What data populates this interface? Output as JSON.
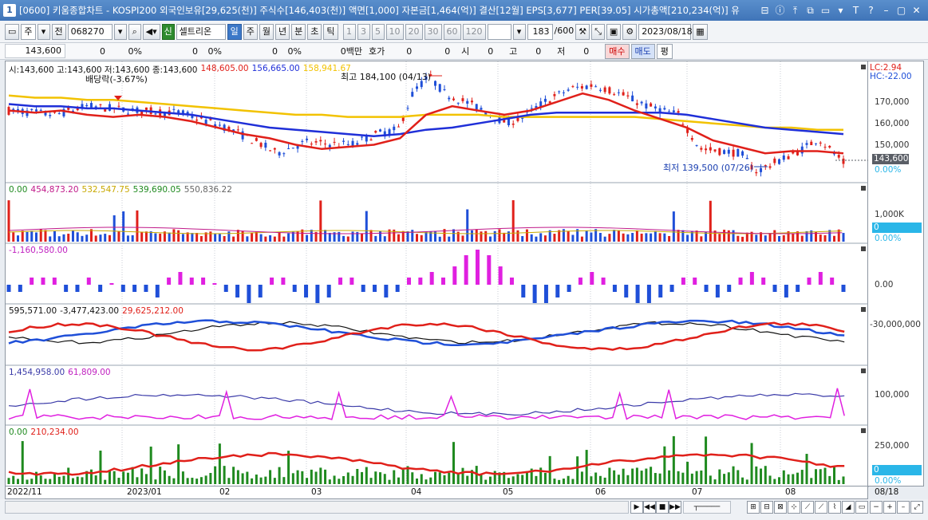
{
  "window": {
    "number": "1",
    "title": "[0600] 키움종합차트 - KOSPI200 외국인보유[29,625(천)] 주식수[146,403(천)] 액면[1,000] 자본금[1,464(억)] 결산[12월] EPS[3,677] PER[39.05] 시가총액[210,234(억)] 유",
    "buttons": [
      "⊟",
      "ⓘ",
      "⤒",
      "⧉",
      "▭",
      "▾",
      "T",
      "?",
      "–",
      "▢",
      "✕"
    ]
  },
  "toolbar": {
    "market": "주",
    "whole": "전",
    "code": "068270",
    "stock_name": "셀트리온",
    "periods": [
      "일",
      "주",
      "월",
      "년",
      "분",
      "초",
      "틱"
    ],
    "selected_period": "일",
    "intervals": [
      "1",
      "3",
      "5",
      "10",
      "20",
      "30",
      "60",
      "120"
    ],
    "count": "183",
    "max_count": "/600",
    "date": "2023/08/18"
  },
  "infobar": {
    "price": "143,600",
    "change": "0",
    "rate": "0%",
    "v1": "0",
    "v1_rate": "0%",
    "v2": "0",
    "v2_rate": "0%",
    "amount": "0백만",
    "hoga_label": "호가",
    "hoga_v1": "0",
    "hoga_v2": "0",
    "si_label": "시",
    "si_val": "0",
    "go_label": "고",
    "go_val": "0",
    "jeo_label": "저",
    "jeo_val": "0",
    "buy": "매수",
    "sell": "매도",
    "flat": "평"
  },
  "price_panel": {
    "ohlc": "시:143,600 고:143,600 저:143,600 종:143,600",
    "ma1": "148,605.00",
    "ma2": "156,665.00",
    "ma3": "158,941.67",
    "dividend": "배당락(-3.67%)",
    "high_label": "최고 184,100 (04/13)",
    "low_label": "최저 139,500 (07/26)",
    "lc": "LC:2.94",
    "hc": "HC:-22.00",
    "current_price": "143,600",
    "zero_pct": "0.00%",
    "ticks": [
      "170,000",
      "160,000",
      "150,000"
    ]
  },
  "volume_panel": {
    "legend": [
      "0.00",
      "454,873.20",
      "532,547.75",
      "539,690.05",
      "550,836.22"
    ],
    "tick": "1,000K",
    "zero": "0",
    "zero_pct": "0.00%"
  },
  "foreign_panel": {
    "legend": "-1,160,580.00",
    "tick": "0.00"
  },
  "flow_panel": {
    "legend": [
      "595,571.00",
      "-3,477,423.00",
      "29,625,212.00"
    ],
    "tick": "-30,000,000"
  },
  "short_panel": {
    "legend": [
      "1,454,958.00",
      "61,809.00"
    ],
    "tick": "100,000"
  },
  "cap_panel": {
    "legend": [
      "0.00",
      "210,234.00"
    ],
    "tick": "250,000",
    "zero": "0",
    "zero_pct": "0.00%"
  },
  "date_axis": [
    "2022/11",
    "2023/01",
    "02",
    "03",
    "04",
    "05",
    "06",
    "07",
    "08",
    "08/18"
  ],
  "colors": {
    "up": "#e0201a",
    "down": "#1f4fd8",
    "ma_red": "#e0201a",
    "ma_blue": "#1f2fd8",
    "ma_yellow": "#f2c200",
    "magenta": "#e020e0",
    "green": "#1f8a1f",
    "cyan": "#2ab6e8"
  },
  "chart_data": {
    "type": "candlestick",
    "categories": [
      "2022/11",
      "2023/01",
      "02",
      "03",
      "04",
      "05",
      "06",
      "07",
      "08"
    ],
    "price_ma_short": [
      168000,
      167000,
      168000,
      166000,
      165000,
      166000,
      165000,
      163000,
      160000,
      157000,
      155000,
      152000,
      150000,
      151000,
      152000,
      155000,
      166000,
      170000,
      168000,
      166000,
      168000,
      172000,
      176000,
      173000,
      168000,
      164000,
      160000,
      154000,
      151000,
      148000,
      149000,
      149000,
      148000
    ],
    "price_ma_mid": [
      171000,
      170000,
      170000,
      169000,
      169000,
      168000,
      167000,
      166000,
      164000,
      162000,
      160000,
      159000,
      158000,
      157000,
      156000,
      157000,
      159000,
      160000,
      162000,
      164000,
      166000,
      167000,
      167000,
      167000,
      167000,
      167000,
      166000,
      164000,
      162000,
      160000,
      159000,
      158000,
      157000
    ],
    "price_ma_long": [
      175000,
      174000,
      174000,
      173000,
      173000,
      172000,
      171000,
      170000,
      169000,
      168000,
      167000,
      166000,
      166000,
      165000,
      165000,
      165000,
      166000,
      166000,
      166000,
      165000,
      165000,
      165000,
      165000,
      165000,
      165000,
      164000,
      163000,
      162000,
      161000,
      160000,
      160000,
      159000,
      159000
    ],
    "foreign_bars": [
      -1,
      -1,
      1,
      1,
      1,
      -1,
      -1,
      1,
      -1,
      0,
      -1,
      -1,
      -1,
      -2,
      1,
      2,
      1,
      1,
      0,
      -1,
      -2,
      -3,
      -2,
      1,
      1,
      -1,
      -2,
      -3,
      -2,
      1,
      1,
      -1,
      -1,
      -2,
      -1,
      1,
      1,
      2,
      1,
      3,
      5,
      6,
      5,
      3,
      1,
      -2,
      -3,
      -3,
      -2,
      -1,
      1,
      2,
      1,
      -1,
      -2,
      -3,
      -3,
      -2,
      -1,
      1,
      1,
      -1,
      -2,
      -1,
      1,
      2,
      1,
      -1,
      -2,
      -1,
      1,
      2,
      1,
      -1
    ]
  }
}
